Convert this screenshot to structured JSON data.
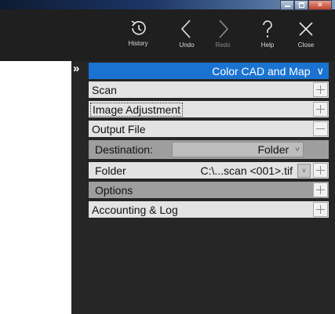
{
  "toolbar": {
    "buttons": [
      {
        "label": "History",
        "icon": "history-icon",
        "enabled": true
      },
      {
        "label": "Undo",
        "icon": "chevron-left-icon",
        "enabled": true
      },
      {
        "label": "Redo",
        "icon": "chevron-right-icon",
        "enabled": false
      },
      {
        "label": "Help",
        "icon": "question-icon",
        "enabled": true
      },
      {
        "label": "Close",
        "icon": "close-icon",
        "enabled": true
      }
    ]
  },
  "panel": {
    "collapse_glyph": "»",
    "header": {
      "title": "Color CAD and Map",
      "chevron": "∨"
    },
    "sections": [
      {
        "label": "Scan",
        "state": "collapsed"
      },
      {
        "label": "Image Adjustment",
        "state": "collapsed"
      },
      {
        "label": "Output File",
        "state": "expanded"
      }
    ],
    "output": {
      "destination": {
        "label": "Destination:",
        "value": "Folder",
        "caret": "˅"
      },
      "folder": {
        "label": "Folder",
        "value": "C:\\...scan <001>.tif",
        "caret": "˅"
      },
      "options": {
        "label": "Options"
      }
    },
    "accounting": {
      "label": "Accounting & Log"
    }
  },
  "colors": {
    "toolbar_bg": "#1f1f1f",
    "panel_bg": "#262626",
    "accent": "#1a73d1",
    "row_bg": "#e3e3e3",
    "subrow_bg": "#9e9e9e"
  }
}
